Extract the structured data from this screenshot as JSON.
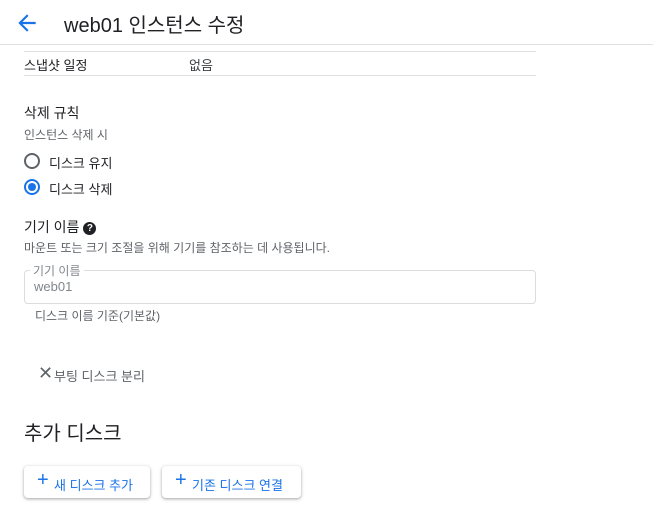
{
  "header": {
    "title": "web01 인스턴스 수정"
  },
  "snapshot": {
    "key": "스냅샷 일정",
    "value": "없음"
  },
  "delete_rule": {
    "title": "삭제 규칙",
    "subtitle": "인스턴스 삭제 시",
    "options": [
      {
        "label": "디스크 유지",
        "checked": false
      },
      {
        "label": "디스크 삭제",
        "checked": true
      }
    ]
  },
  "device_name": {
    "title": "기기 이름",
    "description": "마운트 또는 크기 조절을 위해 기기를 참조하는 데 사용됩니다.",
    "field_label": "기기 이름",
    "field_value": "web01",
    "hint": "디스크 이름 기준(기본값)"
  },
  "detach": {
    "label": "부팅 디스크 분리"
  },
  "additional_disks": {
    "title": "추가 디스크",
    "add_new_label": "새 디스크 추가",
    "attach_existing_label": "기존 디스크 연결"
  },
  "colors": {
    "accent": "#1a73e8",
    "text": "#202124",
    "muted": "#5f6368"
  }
}
